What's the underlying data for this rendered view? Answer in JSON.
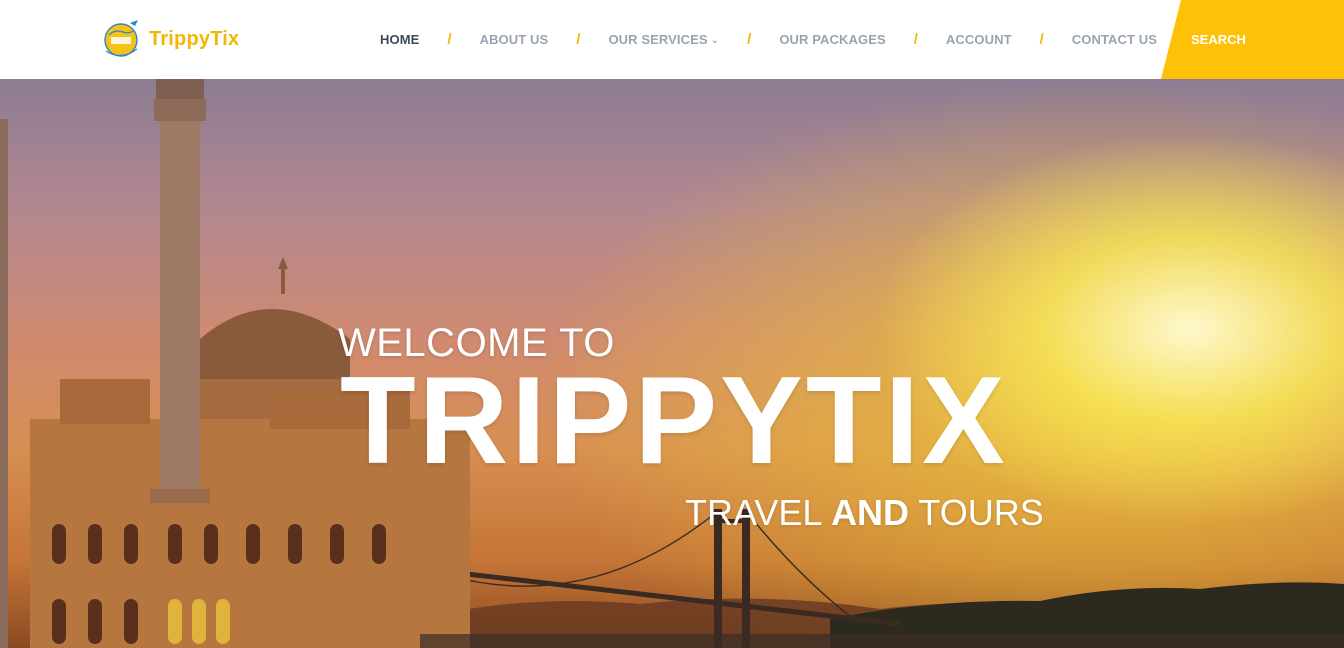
{
  "header": {
    "logo_text": "TrippyTix",
    "logo_icon": "globe-airplane-logo",
    "nav": [
      {
        "label": "HOME",
        "active": true
      },
      {
        "label": "ABOUT US",
        "active": false
      },
      {
        "label": "OUR SERVICES",
        "active": false,
        "dropdown": true
      },
      {
        "label": "OUR PACKAGES",
        "active": false
      },
      {
        "label": "ACCOUNT",
        "active": false
      },
      {
        "label": "CONTACT US",
        "active": false
      }
    ],
    "separator": "/",
    "search_label": "SEARCH"
  },
  "hero": {
    "welcome": "WELCOME TO",
    "title": "TRIPPYTIX",
    "tagline_part1": "TRAVEL",
    "tagline_bold": "AND",
    "tagline_part2": "TOURS"
  },
  "colors": {
    "accent": "#fec107",
    "nav_text": "#9aa4b0",
    "nav_active": "#3b4a5a",
    "logo_text": "#f2b705"
  }
}
